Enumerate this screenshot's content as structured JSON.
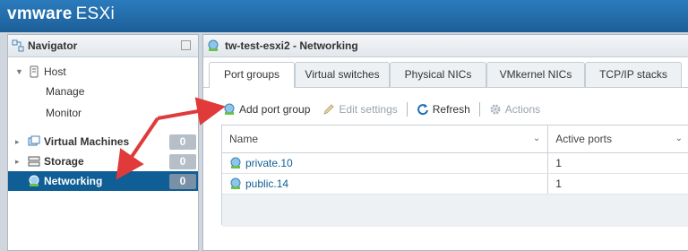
{
  "app": {
    "brand_vm": "vmware",
    "brand_product": "ESXi"
  },
  "navigator": {
    "title": "Navigator",
    "items": [
      {
        "label": "Host"
      },
      {
        "label": "Manage"
      },
      {
        "label": "Monitor"
      },
      {
        "label": "Virtual Machines",
        "count": "0"
      },
      {
        "label": "Storage",
        "count": "0"
      },
      {
        "label": "Networking",
        "count": "0"
      }
    ]
  },
  "main": {
    "title": "tw-test-esxi2 - Networking",
    "tabs": [
      {
        "label": "Port groups"
      },
      {
        "label": "Virtual switches"
      },
      {
        "label": "Physical NICs"
      },
      {
        "label": "VMkernel NICs"
      },
      {
        "label": "TCP/IP stacks"
      }
    ],
    "toolbar": {
      "add": "Add port group",
      "edit": "Edit settings",
      "refresh": "Refresh",
      "actions": "Actions"
    },
    "table": {
      "columns": [
        "Name",
        "Active ports"
      ],
      "rows": [
        {
          "name": "private.10",
          "active_ports": "1"
        },
        {
          "name": "public.14",
          "active_ports": "1"
        }
      ]
    }
  },
  "colors": {
    "accent": "#0f5e95",
    "arrow": "#e03a3a",
    "topbar": "#1d5f98"
  }
}
